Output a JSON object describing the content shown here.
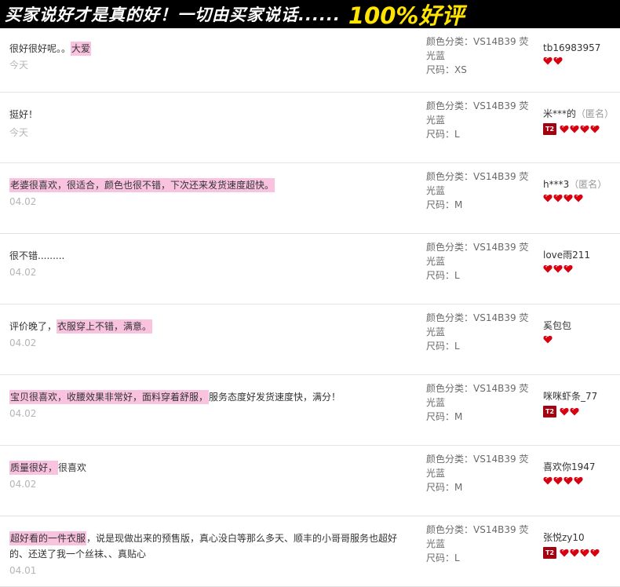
{
  "banner": {
    "text": "买家说好才是真的好！一切由买家说话......",
    "highlight": "100%好评"
  },
  "reviews": [
    {
      "segments": [
        {
          "text": "很好很好呢。。",
          "hl": false
        },
        {
          "text": "大爱",
          "hl": true
        }
      ],
      "date": "今天",
      "sku_color": "颜色分类：VS14B39 荧光蓝",
      "sku_size": "尺码：XS",
      "buyer": "tb16983957",
      "anon": "",
      "tm": false,
      "hearts": 2
    },
    {
      "segments": [
        {
          "text": "挺好！",
          "hl": false
        }
      ],
      "date": "今天",
      "sku_color": "颜色分类：VS14B39 荧光蓝",
      "sku_size": "尺码：L",
      "buyer": "米***的",
      "anon": "（匿名）",
      "tm": true,
      "tm_label": "T2",
      "hearts": 4
    },
    {
      "segments": [
        {
          "text": "老婆很喜欢，很适合，颜色也很不错，下次还来发货速度超快。",
          "hl": true
        }
      ],
      "date": "04.02",
      "sku_color": "颜色分类：VS14B39 荧光蓝",
      "sku_size": "尺码：M",
      "buyer": "h***3",
      "anon": "（匿名）",
      "tm": false,
      "hearts": 4
    },
    {
      "segments": [
        {
          "text": "很不错.........",
          "hl": false
        }
      ],
      "date": "04.02",
      "sku_color": "颜色分类：VS14B39 荧光蓝",
      "sku_size": "尺码：L",
      "buyer": "love雨211",
      "anon": "",
      "tm": false,
      "hearts": 3
    },
    {
      "segments": [
        {
          "text": "评价晚了，",
          "hl": false
        },
        {
          "text": "衣服穿上不错，满意。",
          "hl": true
        }
      ],
      "date": "04.02",
      "sku_color": "颜色分类：VS14B39 荧光蓝",
      "sku_size": "尺码：L",
      "buyer": "奚包包",
      "anon": "",
      "tm": false,
      "hearts": 1
    },
    {
      "segments": [
        {
          "text": "宝贝很喜欢，收腰效果非常好，面料穿着舒服，",
          "hl": true
        },
        {
          "text": "服务态度好发货速度快，满分！",
          "hl": false
        }
      ],
      "date": "04.02",
      "sku_color": "颜色分类：VS14B39 荧光蓝",
      "sku_size": "尺码：M",
      "buyer": "咪咪虾条_77",
      "anon": "",
      "tm": true,
      "tm_label": "T2",
      "hearts": 2
    },
    {
      "segments": [
        {
          "text": "质量很好，",
          "hl": true
        },
        {
          "text": "很喜欢",
          "hl": false
        }
      ],
      "date": "04.02",
      "sku_color": "颜色分类：VS14B39 荧光蓝",
      "sku_size": "尺码：M",
      "buyer": "喜欢你1947",
      "anon": "",
      "tm": false,
      "hearts": 4
    },
    {
      "segments": [
        {
          "text": "超好看的一件衣服",
          "hl": true
        },
        {
          "text": "，说是现做出来的预售版，真心没白等那么多天、顺丰的小哥哥服务也超好的、还送了我一个丝袜、、真贴心",
          "hl": false
        }
      ],
      "date": "04.01",
      "sku_color": "颜色分类：VS14B39 荧光蓝",
      "sku_size": "尺码：L",
      "buyer": "张悦zy10",
      "anon": "",
      "tm": true,
      "tm_label": "T2",
      "hearts": 4,
      "twoline": true
    }
  ],
  "colors": {
    "highlight": "#f9c3e0",
    "heart": "#d8000f",
    "tm_badge": "#a5000f",
    "banner_yellow": "#ffe400"
  },
  "icons": {
    "heart": "heart-rank-icon",
    "tm": "tmall-level-badge-icon"
  }
}
